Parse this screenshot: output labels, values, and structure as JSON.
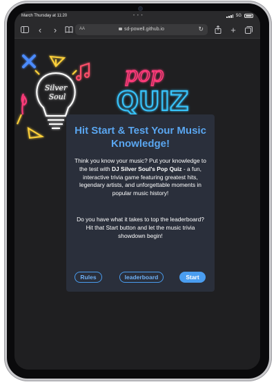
{
  "status_bar": {
    "time": "March Thursday at 11:20",
    "network": "5G"
  },
  "toolbar": {
    "url_prefix": "AA",
    "url": "sd-powell.github.io"
  },
  "hero": {
    "logo_text_1": "Silver",
    "logo_text_2": "Soul",
    "neon_pop": "pop",
    "neon_quiz": "QUIZ"
  },
  "card": {
    "heading": "Hit Start & Test Your Music Knowledge!",
    "p1_a": "Think you know your music? Put your knowledge to the test with ",
    "p1_bold": "DJ Silver Soul's Pop Quiz",
    "p1_b": " - a fun, interactive trivia game featuring greatest hits, legendary artists, and unforgettable moments in popular music history!",
    "p2": "Do you have what it takes to top the leaderboard? Hit that Start button and let the music trivia showdown begin!",
    "buttons": {
      "rules": "Rules",
      "leaderboard": "leaderboard",
      "start": "Start"
    }
  },
  "colors": {
    "accent": "#4a9df0",
    "card_bg": "#2a2f3b",
    "page_bg": "#1f1f21",
    "neon_pink": "#ff3b7a",
    "neon_blue": "#38c6ff"
  }
}
